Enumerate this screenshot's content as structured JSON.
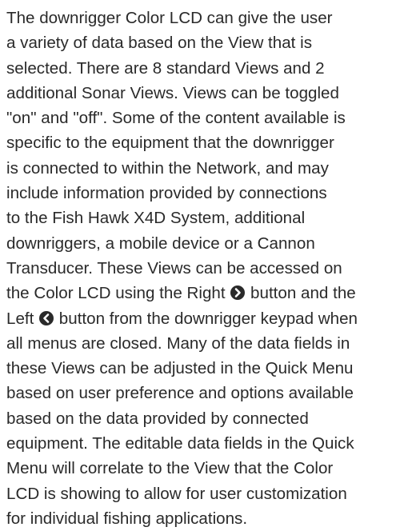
{
  "paragraph": {
    "l01": "The downrigger Color LCD can give the user",
    "l02": "a variety of data based on the View that is",
    "l03": "selected. There are 8 standard Views and 2",
    "l04": "additional Sonar Views. Views can be toggled",
    "l05": "\"on\" and \"off\". Some of the content available is",
    "l06": "specific to the equipment that the downrigger",
    "l07": "is connected to within the Network, and may",
    "l08": "include information provided by connections",
    "l09": "to the Fish Hawk X4D System, additional",
    "l10": "downriggers, a mobile device or a Cannon",
    "l11": "Transducer. These Views can be accessed on",
    "l12a": "the Color LCD using the Right ",
    "l12b": " button and the",
    "l13a": "Left ",
    "l13b": " button from the downrigger keypad when",
    "l14": "all menus are closed. Many of the data fields in",
    "l15": "these Views can be adjusted in the Quick Menu",
    "l16": "based on user preference and options available",
    "l17": "based on the data provided by connected",
    "l18": "equipment. The editable data fields in the Quick",
    "l19": "Menu will correlate to the View that the Color",
    "l20": "LCD is showing to allow for user customization",
    "l21": "for individual fishing applications."
  },
  "icons": {
    "right": "right-arrow-button-icon",
    "left": "left-arrow-button-icon"
  },
  "colors": {
    "text": "#2a2a2a",
    "background": "#ffffff"
  }
}
